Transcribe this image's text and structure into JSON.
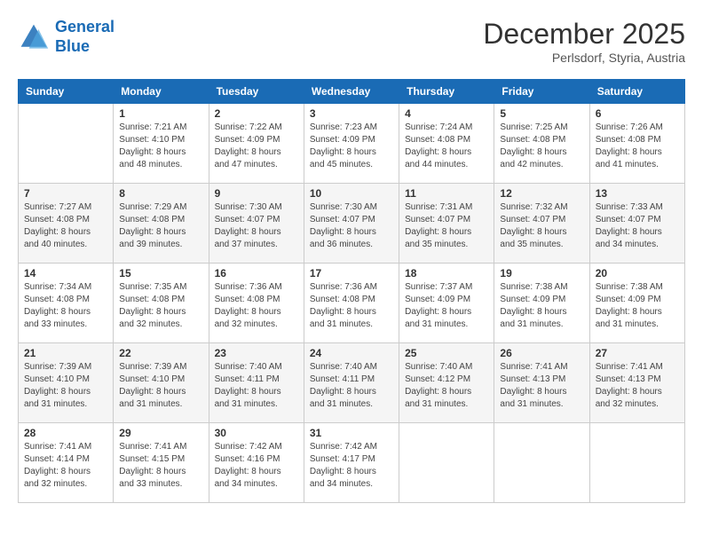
{
  "header": {
    "logo_line1": "General",
    "logo_line2": "Blue",
    "month": "December 2025",
    "location": "Perlsdorf, Styria, Austria"
  },
  "weekdays": [
    "Sunday",
    "Monday",
    "Tuesday",
    "Wednesday",
    "Thursday",
    "Friday",
    "Saturday"
  ],
  "weeks": [
    [
      {
        "day": "",
        "info": ""
      },
      {
        "day": "1",
        "info": "Sunrise: 7:21 AM\nSunset: 4:10 PM\nDaylight: 8 hours\nand 48 minutes."
      },
      {
        "day": "2",
        "info": "Sunrise: 7:22 AM\nSunset: 4:09 PM\nDaylight: 8 hours\nand 47 minutes."
      },
      {
        "day": "3",
        "info": "Sunrise: 7:23 AM\nSunset: 4:09 PM\nDaylight: 8 hours\nand 45 minutes."
      },
      {
        "day": "4",
        "info": "Sunrise: 7:24 AM\nSunset: 4:08 PM\nDaylight: 8 hours\nand 44 minutes."
      },
      {
        "day": "5",
        "info": "Sunrise: 7:25 AM\nSunset: 4:08 PM\nDaylight: 8 hours\nand 42 minutes."
      },
      {
        "day": "6",
        "info": "Sunrise: 7:26 AM\nSunset: 4:08 PM\nDaylight: 8 hours\nand 41 minutes."
      }
    ],
    [
      {
        "day": "7",
        "info": "Sunrise: 7:27 AM\nSunset: 4:08 PM\nDaylight: 8 hours\nand 40 minutes."
      },
      {
        "day": "8",
        "info": "Sunrise: 7:29 AM\nSunset: 4:08 PM\nDaylight: 8 hours\nand 39 minutes."
      },
      {
        "day": "9",
        "info": "Sunrise: 7:30 AM\nSunset: 4:07 PM\nDaylight: 8 hours\nand 37 minutes."
      },
      {
        "day": "10",
        "info": "Sunrise: 7:30 AM\nSunset: 4:07 PM\nDaylight: 8 hours\nand 36 minutes."
      },
      {
        "day": "11",
        "info": "Sunrise: 7:31 AM\nSunset: 4:07 PM\nDaylight: 8 hours\nand 35 minutes."
      },
      {
        "day": "12",
        "info": "Sunrise: 7:32 AM\nSunset: 4:07 PM\nDaylight: 8 hours\nand 35 minutes."
      },
      {
        "day": "13",
        "info": "Sunrise: 7:33 AM\nSunset: 4:07 PM\nDaylight: 8 hours\nand 34 minutes."
      }
    ],
    [
      {
        "day": "14",
        "info": "Sunrise: 7:34 AM\nSunset: 4:08 PM\nDaylight: 8 hours\nand 33 minutes."
      },
      {
        "day": "15",
        "info": "Sunrise: 7:35 AM\nSunset: 4:08 PM\nDaylight: 8 hours\nand 32 minutes."
      },
      {
        "day": "16",
        "info": "Sunrise: 7:36 AM\nSunset: 4:08 PM\nDaylight: 8 hours\nand 32 minutes."
      },
      {
        "day": "17",
        "info": "Sunrise: 7:36 AM\nSunset: 4:08 PM\nDaylight: 8 hours\nand 31 minutes."
      },
      {
        "day": "18",
        "info": "Sunrise: 7:37 AM\nSunset: 4:09 PM\nDaylight: 8 hours\nand 31 minutes."
      },
      {
        "day": "19",
        "info": "Sunrise: 7:38 AM\nSunset: 4:09 PM\nDaylight: 8 hours\nand 31 minutes."
      },
      {
        "day": "20",
        "info": "Sunrise: 7:38 AM\nSunset: 4:09 PM\nDaylight: 8 hours\nand 31 minutes."
      }
    ],
    [
      {
        "day": "21",
        "info": "Sunrise: 7:39 AM\nSunset: 4:10 PM\nDaylight: 8 hours\nand 31 minutes."
      },
      {
        "day": "22",
        "info": "Sunrise: 7:39 AM\nSunset: 4:10 PM\nDaylight: 8 hours\nand 31 minutes."
      },
      {
        "day": "23",
        "info": "Sunrise: 7:40 AM\nSunset: 4:11 PM\nDaylight: 8 hours\nand 31 minutes."
      },
      {
        "day": "24",
        "info": "Sunrise: 7:40 AM\nSunset: 4:11 PM\nDaylight: 8 hours\nand 31 minutes."
      },
      {
        "day": "25",
        "info": "Sunrise: 7:40 AM\nSunset: 4:12 PM\nDaylight: 8 hours\nand 31 minutes."
      },
      {
        "day": "26",
        "info": "Sunrise: 7:41 AM\nSunset: 4:13 PM\nDaylight: 8 hours\nand 31 minutes."
      },
      {
        "day": "27",
        "info": "Sunrise: 7:41 AM\nSunset: 4:13 PM\nDaylight: 8 hours\nand 32 minutes."
      }
    ],
    [
      {
        "day": "28",
        "info": "Sunrise: 7:41 AM\nSunset: 4:14 PM\nDaylight: 8 hours\nand 32 minutes."
      },
      {
        "day": "29",
        "info": "Sunrise: 7:41 AM\nSunset: 4:15 PM\nDaylight: 8 hours\nand 33 minutes."
      },
      {
        "day": "30",
        "info": "Sunrise: 7:42 AM\nSunset: 4:16 PM\nDaylight: 8 hours\nand 34 minutes."
      },
      {
        "day": "31",
        "info": "Sunrise: 7:42 AM\nSunset: 4:17 PM\nDaylight: 8 hours\nand 34 minutes."
      },
      {
        "day": "",
        "info": ""
      },
      {
        "day": "",
        "info": ""
      },
      {
        "day": "",
        "info": ""
      }
    ]
  ]
}
